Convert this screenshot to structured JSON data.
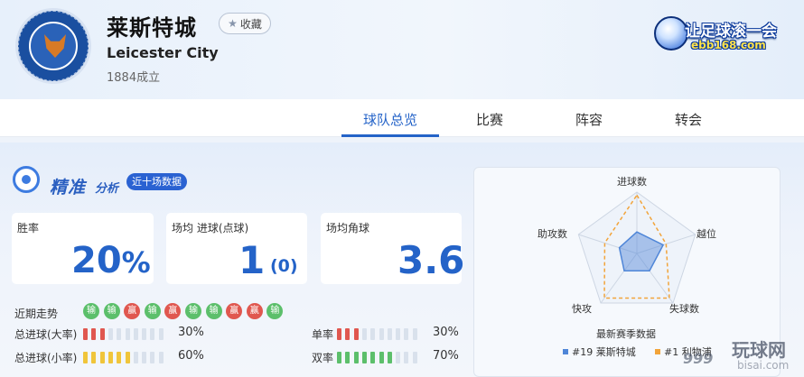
{
  "team": {
    "name_cn": "莱斯特城",
    "name_en": "Leicester City",
    "founded": "1884成立",
    "favorite_label": "收藏",
    "crest_text": "LEICESTER CITY FOOTBALL CLUB"
  },
  "site_logo": {
    "line1": "让足球滚一会",
    "line2": "ebb168.com"
  },
  "tabs": [
    {
      "label": "球队总览",
      "active": true
    },
    {
      "label": "比赛",
      "active": false
    },
    {
      "label": "阵容",
      "active": false
    },
    {
      "label": "转会",
      "active": false
    }
  ],
  "analysis": {
    "title": "精准",
    "title_small": "分析",
    "badge": "近十场数据",
    "cards": [
      {
        "label": "胜率",
        "value": "20",
        "unit": "%"
      },
      {
        "label": "场均 进球(点球)",
        "value": "1",
        "sub": "(0)"
      },
      {
        "label": "场均角球",
        "value": "3.6"
      }
    ],
    "trend": {
      "label": "近期走势",
      "results": [
        "输",
        "输",
        "赢",
        "输",
        "赢",
        "输",
        "输",
        "赢",
        "赢",
        "输"
      ]
    },
    "stats": [
      {
        "label": "总进球(大率)",
        "percent": 30,
        "pct_text": "30%",
        "color": "#e0574f"
      },
      {
        "label": "总进球(小率)",
        "percent": 60,
        "pct_text": "60%",
        "color": "#f0c53a"
      },
      {
        "label": "单率",
        "percent": 30,
        "pct_text": "30%",
        "color": "#e0574f"
      },
      {
        "label": "双率",
        "percent": 70,
        "pct_text": "70%",
        "color": "#5cbf6b"
      }
    ]
  },
  "radar": {
    "axes": [
      "进球数",
      "越位",
      "失球数",
      "快攻",
      "助攻数"
    ],
    "title": "最新赛季数据",
    "series": [
      {
        "name": "#19 莱斯特城",
        "color": "#4f86d8",
        "values": [
          0.35,
          0.45,
          0.35,
          0.35,
          0.3
        ]
      },
      {
        "name": "#1 利物浦",
        "color": "#f2a43a",
        "values": [
          0.95,
          0.5,
          0.9,
          0.9,
          0.55
        ]
      }
    ]
  },
  "watermark": {
    "brand": "玩球网",
    "domain": "bisai.com",
    "prefix": "999"
  }
}
